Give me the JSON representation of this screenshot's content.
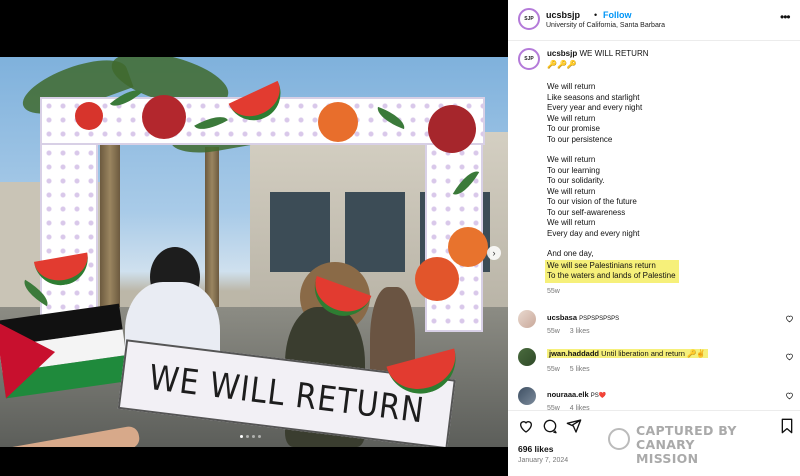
{
  "post": {
    "username": "ucsbsjp",
    "avatar_text": "SJP",
    "follow_label": "Follow",
    "separator": "•",
    "location": "University of California, Santa Barbara",
    "banner_text": "WE WILL RETURN",
    "carousel_count": 4,
    "carousel_active": 0
  },
  "caption": {
    "username": "ucsbsjp",
    "title": "WE WILL RETURN",
    "emoji": "🔑🔑🔑",
    "stanza1": [
      "We will return",
      "Like seasons and starlight",
      "Every year and every night",
      "We will return",
      "To our promise",
      "To our persistence"
    ],
    "stanza2": [
      "We will return",
      "To our learning",
      "To our solidarity.",
      "We will return",
      "To our vision of the future",
      "To our self-awareness",
      "We will return",
      "Every day and every night"
    ],
    "stanza3_intro": "And one day,",
    "stanza3_highlight": [
      "We will see Palestinians return",
      "To the waters and lands of Palestine"
    ],
    "age": "55w"
  },
  "comments": [
    {
      "username": "ucsbasa",
      "text": "PSPSPSPSPS",
      "age": "55w",
      "likes": "3 likes",
      "highlighted": false
    },
    {
      "username": "jwan.haddadd",
      "text": "Until liberation and return 🔑✌",
      "age": "55w",
      "likes": "5 likes",
      "highlighted": true
    },
    {
      "username": "nouraaa.elk",
      "text": "PS❤️",
      "age": "55w",
      "likes": "4 likes",
      "highlighted": false
    }
  ],
  "footer": {
    "likes": "696 likes",
    "date": "January 7, 2024"
  },
  "watermark": {
    "line1": "CAPTURED BY",
    "line2": "CANARY MISSION"
  },
  "colors": {
    "follow": "#0095f6",
    "highlight": "#f6f07a",
    "avatar_ring": "#b47ad9"
  },
  "icons": [
    "more-options-icon",
    "next-slide-icon",
    "heart-icon",
    "comment-icon",
    "share-icon",
    "bookmark-icon"
  ]
}
